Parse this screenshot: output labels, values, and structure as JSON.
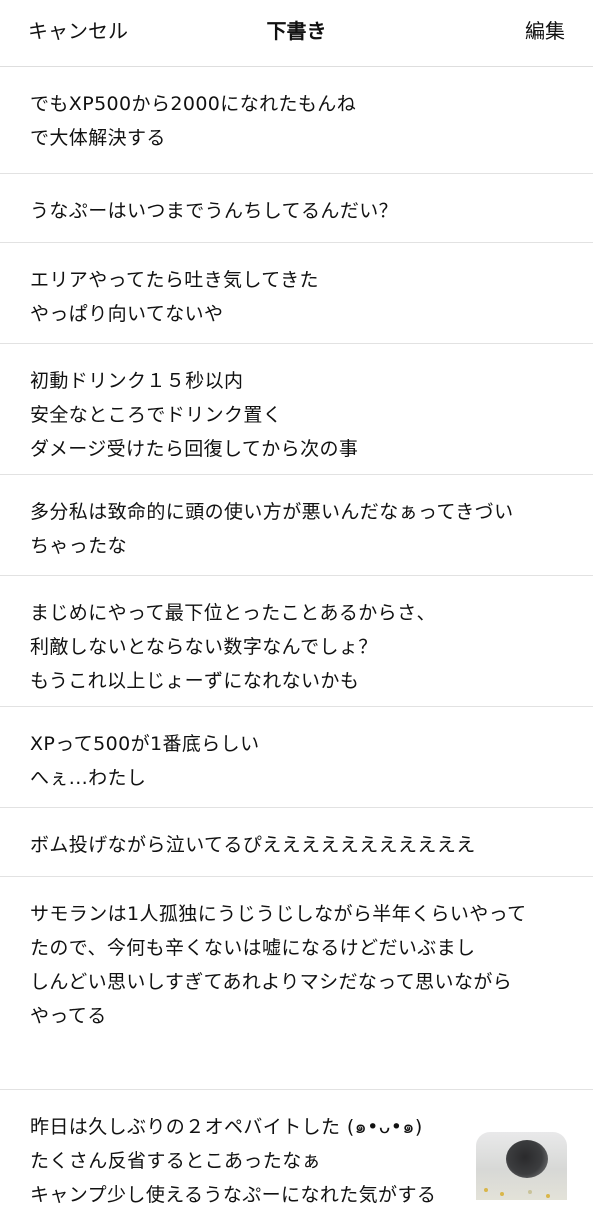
{
  "header": {
    "cancel_label": "キャンセル",
    "title": "下書き",
    "edit_label": "編集"
  },
  "drafts": [
    {
      "text": "でもXP500から2000になれたもんね\nで大体解決する"
    },
    {
      "text": "うなぷーはいつまでうんちしてるんだい？"
    },
    {
      "text": "エリアやってたら吐き気してきた\nやっぱり向いてないや"
    },
    {
      "text": "初動ドリンク１５秒以内\n安全なところでドリンク置く\nダメージ受けたら回復してから次の事"
    },
    {
      "text": "多分私は致命的に頭の使い方が悪いんだなぁってきづい\nちゃったな"
    },
    {
      "text": "まじめにやって最下位とったことあるからさ、\n利敵しないとならない数字なんでしょ？\nもうこれ以上じょーずになれないかも"
    },
    {
      "text": "XPって500が1番底らしい\nへぇ...わたし"
    },
    {
      "text": "ボム投げながら泣いてるぴえええええええええええ"
    },
    {
      "text": "サモランは1人孤独にうじうじしながら半年くらいやって\nたので、今何も辛くないは嘘になるけどだいぶまし\nしんどい思いしすぎてあれよりマシだなって思いながら\nやってる"
    },
    {
      "text": "昨日は久しぶりの２オペバイトした (๑•ᴗ•๑)\nたくさん反省するとこあったなぁ\nキャンプ少し使えるうなぷーになれた気がする"
    }
  ]
}
